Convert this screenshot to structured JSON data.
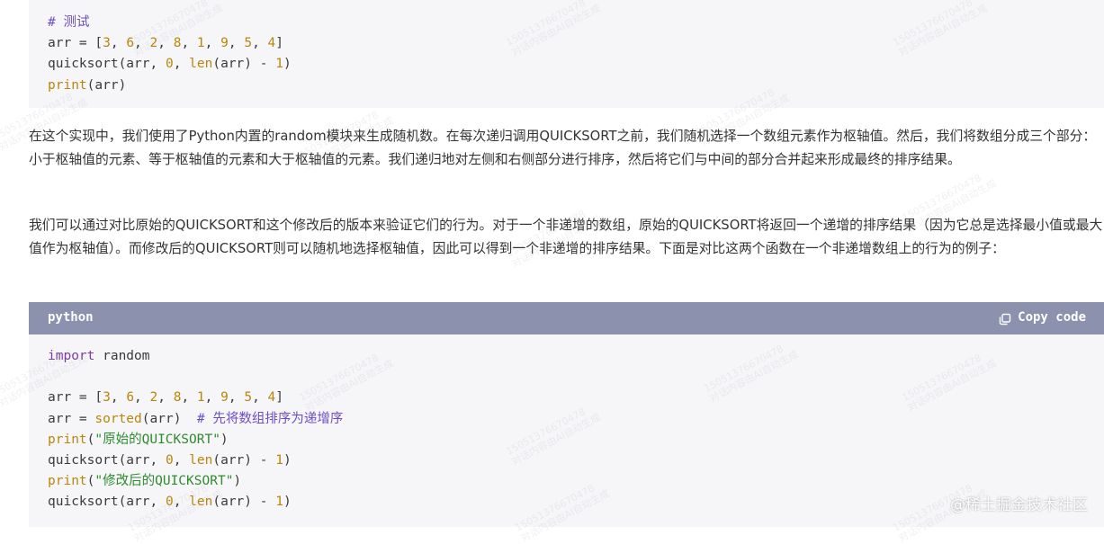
{
  "code_block_1": {
    "lines": [
      [
        {
          "t": "# 测试",
          "c": "comment"
        }
      ],
      [
        {
          "t": "arr = ["
        },
        {
          "t": "3",
          "c": "number"
        },
        {
          "t": ", "
        },
        {
          "t": "6",
          "c": "number"
        },
        {
          "t": ", "
        },
        {
          "t": "2",
          "c": "number"
        },
        {
          "t": ", "
        },
        {
          "t": "8",
          "c": "number"
        },
        {
          "t": ", "
        },
        {
          "t": "1",
          "c": "number"
        },
        {
          "t": ", "
        },
        {
          "t": "9",
          "c": "number"
        },
        {
          "t": ", "
        },
        {
          "t": "5",
          "c": "number"
        },
        {
          "t": ", "
        },
        {
          "t": "4",
          "c": "number"
        },
        {
          "t": "]"
        }
      ],
      [
        {
          "t": "quicksort(arr, "
        },
        {
          "t": "0",
          "c": "number"
        },
        {
          "t": ", "
        },
        {
          "t": "len",
          "c": "builtin"
        },
        {
          "t": "(arr) - "
        },
        {
          "t": "1",
          "c": "number"
        },
        {
          "t": ")"
        }
      ],
      [
        {
          "t": "print",
          "c": "builtin"
        },
        {
          "t": "(arr)"
        }
      ]
    ]
  },
  "paragraph_1": "在这个实现中，我们使用了Python内置的random模块来生成随机数。在每次递归调用QUICKSORT之前，我们随机选择一个数组元素作为枢轴值。然后，我们将数组分成三个部分：小于枢轴值的元素、等于枢轴值的元素和大于枢轴值的元素。我们递归地对左侧和右侧部分进行排序，然后将它们与中间的部分合并起来形成最终的排序结果。",
  "paragraph_2": "我们可以通过对比原始的QUICKSORT和这个修改后的版本来验证它们的行为。对于一个非递增的数组，原始的QUICKSORT将返回一个递增的排序结果（因为它总是选择最小值或最大值作为枢轴值）。而修改后的QUICKSORT则可以随机地选择枢轴值，因此可以得到一个非递增的排序结果。下面是对比这两个函数在一个非递增数组上的行为的例子：",
  "code_block_2": {
    "language": "python",
    "copy_label": "Copy code",
    "copy_icon": "copy-icon",
    "lines": [
      [
        {
          "t": "import",
          "c": "keyword"
        },
        {
          "t": " random"
        }
      ],
      [],
      [
        {
          "t": "arr = ["
        },
        {
          "t": "3",
          "c": "number"
        },
        {
          "t": ", "
        },
        {
          "t": "6",
          "c": "number"
        },
        {
          "t": ", "
        },
        {
          "t": "2",
          "c": "number"
        },
        {
          "t": ", "
        },
        {
          "t": "8",
          "c": "number"
        },
        {
          "t": ", "
        },
        {
          "t": "1",
          "c": "number"
        },
        {
          "t": ", "
        },
        {
          "t": "9",
          "c": "number"
        },
        {
          "t": ", "
        },
        {
          "t": "5",
          "c": "number"
        },
        {
          "t": ", "
        },
        {
          "t": "4",
          "c": "number"
        },
        {
          "t": "]"
        }
      ],
      [
        {
          "t": "arr = "
        },
        {
          "t": "sorted",
          "c": "builtin"
        },
        {
          "t": "(arr)  "
        },
        {
          "t": "# 先将数组排序为递增序",
          "c": "comment"
        }
      ],
      [
        {
          "t": "print",
          "c": "builtin"
        },
        {
          "t": "("
        },
        {
          "t": "\"原始的QUICKSORT\"",
          "c": "string"
        },
        {
          "t": ")"
        }
      ],
      [
        {
          "t": "quicksort(arr, "
        },
        {
          "t": "0",
          "c": "number"
        },
        {
          "t": ", "
        },
        {
          "t": "len",
          "c": "builtin"
        },
        {
          "t": "(arr) - "
        },
        {
          "t": "1",
          "c": "number"
        },
        {
          "t": ")"
        }
      ],
      [
        {
          "t": "print",
          "c": "builtin"
        },
        {
          "t": "("
        },
        {
          "t": "\"修改后的QUICKSORT\"",
          "c": "string"
        },
        {
          "t": ")"
        }
      ],
      [
        {
          "t": "quicksort(arr, "
        },
        {
          "t": "0",
          "c": "number"
        },
        {
          "t": ", "
        },
        {
          "t": "len",
          "c": "builtin"
        },
        {
          "t": "(arr) - "
        },
        {
          "t": "1",
          "c": "number"
        },
        {
          "t": ")"
        }
      ]
    ]
  },
  "watermark_text": "15051376670478\n对话内容由AI自动生成",
  "site_watermark": "@稀土掘金技术社区",
  "colors": {
    "code_bg": "#f6f6f9",
    "header_bg": "#8c91ad",
    "comment": "#6b4fc8",
    "number": "#b8860b",
    "string": "#2e8b2e"
  }
}
